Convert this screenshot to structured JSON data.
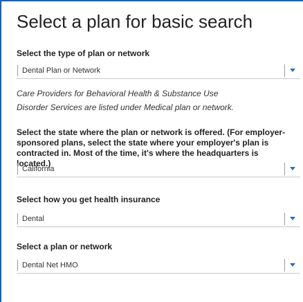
{
  "page": {
    "title": "Select a plan for basic search"
  },
  "plan_type": {
    "label": "Select the type of plan or network",
    "value": "Dental Plan or Network"
  },
  "note": {
    "line1": "Care Providers for Behavioral Health & Substance Use",
    "line2": "Disorder Services are listed under Medical plan or network."
  },
  "state": {
    "label_line1": "Select the state where the plan or network is offered. (For employer-",
    "label_line2": "sponsored plans, select the state where your employer's plan is",
    "label_line3": "contracted in. Most of the time, it's where the headquarters is",
    "label_line4": "located.)",
    "value": "California"
  },
  "insurance_source": {
    "label": "Select how you get health insurance",
    "value": "Dental"
  },
  "plan": {
    "label": "Select a plan or network",
    "value": "Dental Net HMO"
  },
  "colors": {
    "accent": "#1f6fc7",
    "border": "#1f5fa8"
  }
}
